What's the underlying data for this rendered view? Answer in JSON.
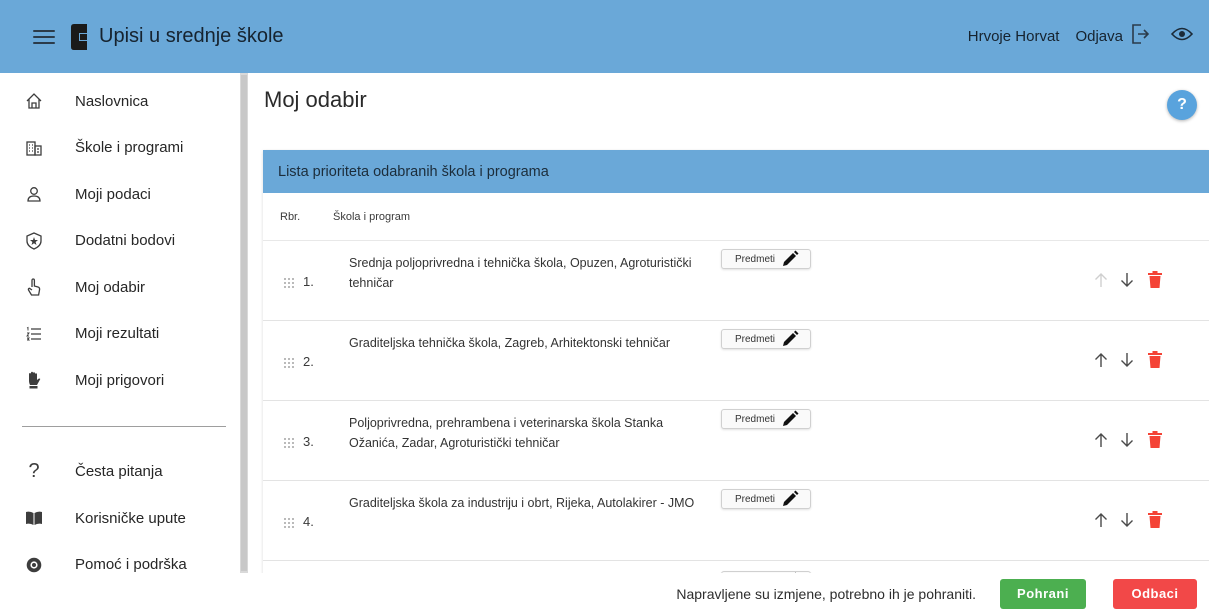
{
  "header": {
    "title": "Upisi u srednje škole",
    "user_name": "Hrvoje Horvat",
    "logout_label": "Odjava"
  },
  "sidebar": {
    "items": [
      {
        "label": "Naslovnica",
        "icon": "home-icon"
      },
      {
        "label": "Škole i programi",
        "icon": "building-icon"
      },
      {
        "label": "Moji podaci",
        "icon": "person-icon"
      },
      {
        "label": "Dodatni bodovi",
        "icon": "star-badge-icon"
      },
      {
        "label": "Moj odabir",
        "icon": "hand-pointer-icon"
      },
      {
        "label": "Moji rezultati",
        "icon": "list-numbered-icon"
      },
      {
        "label": "Moji prigovori",
        "icon": "hand-stop-icon"
      }
    ],
    "secondary_items": [
      {
        "label": "Česta pitanja",
        "icon": "question-icon"
      },
      {
        "label": "Korisničke upute",
        "icon": "book-icon"
      },
      {
        "label": "Pomoć i podrška",
        "icon": "support-icon"
      }
    ]
  },
  "main": {
    "page_title": "Moj odabir",
    "help_label": "?",
    "card_title": "Lista prioriteta odabranih škola i programa",
    "columns": {
      "rbr": "Rbr.",
      "school": "Škola i program"
    },
    "predmeti_label": "Predmeti",
    "rows": [
      {
        "num": "1.",
        "school": "Srednja poljoprivredna i tehnička škola, Opuzen, Agroturistički tehničar"
      },
      {
        "num": "2.",
        "school": "Graditeljska tehnička škola, Zagreb, Arhitektonski tehničar"
      },
      {
        "num": "3.",
        "school": "Poljoprivredna, prehrambena i veterinarska škola Stanka Ožanića, Zadar, Agroturistički tehničar"
      },
      {
        "num": "4.",
        "school": "Graditeljska škola za industriju i obrt, Rijeka, Autolakirer - JMO"
      }
    ]
  },
  "footer": {
    "message": "Napravljene su izmjene, potrebno ih je pohraniti.",
    "save_label": "Pohrani",
    "discard_label": "Odbaci"
  },
  "colors": {
    "topbar": "#6aa8d8",
    "save": "#4caf50",
    "discard": "#f24848",
    "trash": "#f44336"
  }
}
